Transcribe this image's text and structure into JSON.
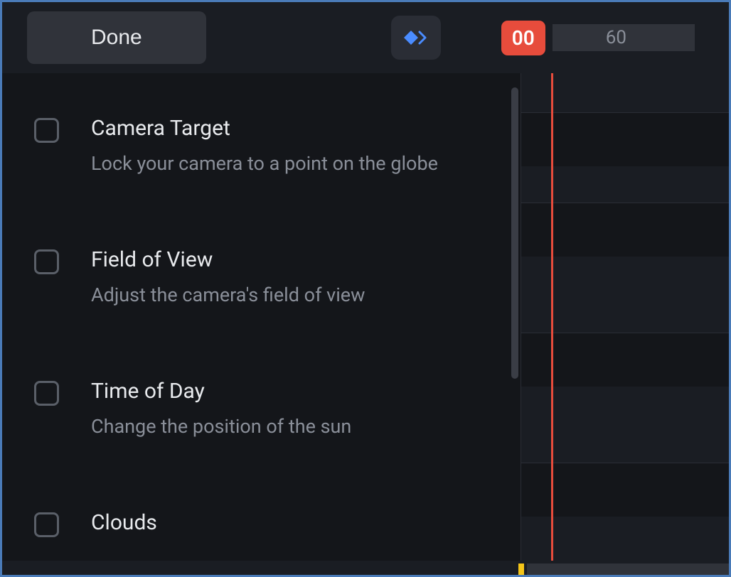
{
  "toolbar": {
    "done_label": "Done",
    "time_current": "00",
    "time_next": "60"
  },
  "options": [
    {
      "title": "Camera Target",
      "desc": "Lock your camera to a point on the globe",
      "checked": false
    },
    {
      "title": "Field of View",
      "desc": "Adjust the camera's field of view",
      "checked": false
    },
    {
      "title": "Time of Day",
      "desc": "Change the position of the sun",
      "checked": false
    },
    {
      "title": "Clouds",
      "desc": "",
      "checked": false
    }
  ],
  "colors": {
    "accent_blue": "#4a8cff",
    "accent_red": "#e74c3c",
    "bg_dark": "#14161a",
    "bg_panel": "#1a1d23"
  }
}
